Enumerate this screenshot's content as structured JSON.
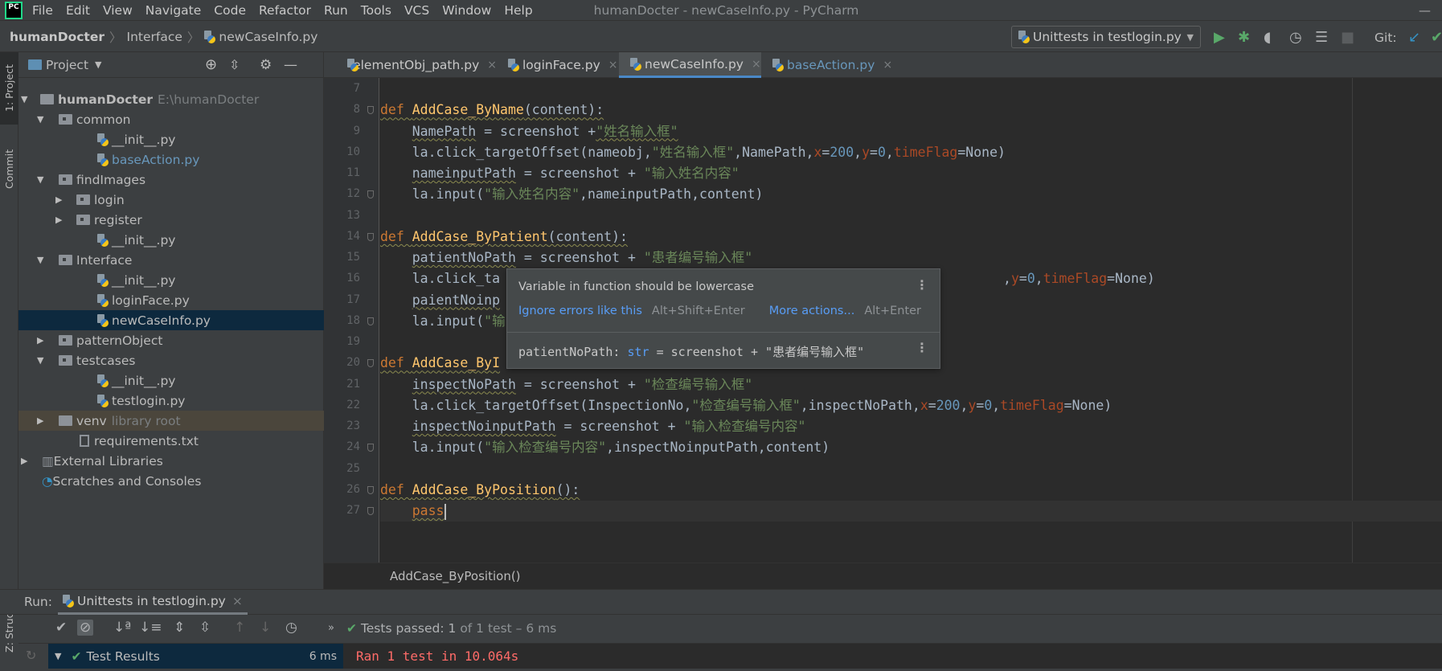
{
  "menu": {
    "items": [
      "File",
      "Edit",
      "View",
      "Navigate",
      "Code",
      "Refactor",
      "Run",
      "Tools",
      "VCS",
      "Window",
      "Help"
    ],
    "window_title": "humanDocter - newCaseInfo.py - PyCharm"
  },
  "navbar": {
    "crumbs": [
      "humanDocter",
      "Interface",
      "newCaseInfo.py"
    ],
    "run_config": "Unittests in testlogin.py",
    "git_label": "Git:"
  },
  "tool_strip": {
    "project": "1: Project",
    "commit": "Commit",
    "structure": "Z: Structure"
  },
  "sidebar": {
    "title": "Project",
    "tree": [
      {
        "label": "humanDocter",
        "hint": "E:\\humanDocter",
        "level": 0,
        "kind": "root",
        "expanded": true
      },
      {
        "label": "common",
        "level": 1,
        "kind": "folder",
        "expanded": true
      },
      {
        "label": "__init__.py",
        "level": 2,
        "kind": "py"
      },
      {
        "label": "baseAction.py",
        "level": 2,
        "kind": "py",
        "modified": true
      },
      {
        "label": "findImages",
        "level": 1,
        "kind": "folder",
        "expanded": true
      },
      {
        "label": "login",
        "level": 2,
        "kind": "folder",
        "expanded": false
      },
      {
        "label": "register",
        "level": 2,
        "kind": "folder",
        "expanded": false
      },
      {
        "label": "__init__.py",
        "level": 2,
        "kind": "py"
      },
      {
        "label": "Interface",
        "level": 1,
        "kind": "folder",
        "expanded": true
      },
      {
        "label": "__init__.py",
        "level": 2,
        "kind": "py"
      },
      {
        "label": "loginFace.py",
        "level": 2,
        "kind": "py"
      },
      {
        "label": "newCaseInfo.py",
        "level": 2,
        "kind": "py",
        "selected": true
      },
      {
        "label": "patternObject",
        "level": 1,
        "kind": "folder",
        "expanded": false
      },
      {
        "label": "testcases",
        "level": 1,
        "kind": "folder",
        "expanded": true
      },
      {
        "label": "__init__.py",
        "level": 2,
        "kind": "py"
      },
      {
        "label": "testlogin.py",
        "level": 2,
        "kind": "py"
      },
      {
        "label": "venv",
        "hint": "library root",
        "level": 1,
        "kind": "libfolder",
        "expanded": false
      },
      {
        "label": "requirements.txt",
        "level": 1,
        "kind": "txt"
      },
      {
        "label": "External Libraries",
        "level": 0,
        "kind": "libs",
        "expanded": false
      },
      {
        "label": "Scratches and Consoles",
        "level": 0,
        "kind": "scratch"
      }
    ]
  },
  "tabs": [
    {
      "label": "elementObj_path.py"
    },
    {
      "label": "loginFace.py"
    },
    {
      "label": "newCaseInfo.py",
      "active": true
    },
    {
      "label": "baseAction.py",
      "modified": true
    }
  ],
  "editor": {
    "lines": [
      {
        "num": "7",
        "tokens": []
      },
      {
        "num": "8",
        "fold": true,
        "tokens": [
          [
            "k",
            "def ",
            1
          ],
          [
            "f",
            "AddCase_ByName",
            1
          ],
          [
            "p",
            "(content):",
            1
          ]
        ]
      },
      {
        "num": "9",
        "tokens": [
          [
            "p",
            "    "
          ],
          [
            "p",
            "NamePath",
            1
          ],
          [
            "p",
            " = screenshot +"
          ],
          [
            "s",
            "\"姓名输入框\"",
            1
          ]
        ]
      },
      {
        "num": "10",
        "tokens": [
          [
            "p",
            "    la.click_targetOffset(nameobj,"
          ],
          [
            "s",
            "\"姓名输入框\""
          ],
          [
            "p",
            ",NamePath,"
          ],
          [
            "a",
            "x"
          ],
          [
            "p",
            "="
          ],
          [
            "n",
            "200"
          ],
          [
            "p",
            ","
          ],
          [
            "a",
            "y"
          ],
          [
            "p",
            "="
          ],
          [
            "n",
            "0"
          ],
          [
            "p",
            ","
          ],
          [
            "a",
            "timeFlag"
          ],
          [
            "p",
            "=None)"
          ]
        ]
      },
      {
        "num": "11",
        "tokens": [
          [
            "p",
            "    "
          ],
          [
            "p",
            "nameinputPath",
            1
          ],
          [
            "p",
            " = screenshot + "
          ],
          [
            "s",
            "\"输入姓名内容\""
          ]
        ]
      },
      {
        "num": "12",
        "fold": true,
        "tokens": [
          [
            "p",
            "    la.input("
          ],
          [
            "s",
            "\"输入姓名内容\""
          ],
          [
            "p",
            ",nameinputPath,content)"
          ]
        ]
      },
      {
        "num": "13",
        "tokens": []
      },
      {
        "num": "14",
        "fold": true,
        "tokens": [
          [
            "k",
            "def ",
            1
          ],
          [
            "f",
            "AddCase_ByPatient",
            1
          ],
          [
            "p",
            "(content):",
            1
          ]
        ]
      },
      {
        "num": "15",
        "tokens": [
          [
            "p",
            "    "
          ],
          [
            "p",
            "patientNoPath",
            1
          ],
          [
            "p",
            " = screenshot + "
          ],
          [
            "s",
            "\"患者编号输入框\""
          ]
        ]
      },
      {
        "num": "16",
        "tokens": [
          [
            "p",
            "    la.click_ta"
          ]
        ],
        "after_popup": [
          [
            "p",
            ","
          ],
          [
            "a",
            "y"
          ],
          [
            "p",
            "="
          ],
          [
            "n",
            "0"
          ],
          [
            "p",
            ","
          ],
          [
            "a",
            "timeFlag"
          ],
          [
            "p",
            "=None)"
          ]
        ]
      },
      {
        "num": "17",
        "tokens": [
          [
            "p",
            "    "
          ],
          [
            "p",
            "paientNoinp",
            1
          ]
        ]
      },
      {
        "num": "18",
        "fold": true,
        "tokens": [
          [
            "p",
            "    la.input("
          ],
          [
            "s",
            "\"输"
          ]
        ]
      },
      {
        "num": "19",
        "tokens": []
      },
      {
        "num": "20",
        "fold": true,
        "tokens": [
          [
            "k",
            "def ",
            1
          ],
          [
            "f",
            "AddCase_ByI",
            1
          ]
        ]
      },
      {
        "num": "21",
        "tokens": [
          [
            "p",
            "    "
          ],
          [
            "p",
            "inspectNoPath",
            1
          ],
          [
            "p",
            " = screenshot + "
          ],
          [
            "s",
            "\"检查编号输入框\""
          ]
        ]
      },
      {
        "num": "22",
        "tokens": [
          [
            "p",
            "    la.click_targetOffset(InspectionNo,"
          ],
          [
            "s",
            "\"检查编号输入框\""
          ],
          [
            "p",
            ",inspectNoPath,"
          ],
          [
            "a",
            "x"
          ],
          [
            "p",
            "="
          ],
          [
            "n",
            "200"
          ],
          [
            "p",
            ","
          ],
          [
            "a",
            "y"
          ],
          [
            "p",
            "="
          ],
          [
            "n",
            "0"
          ],
          [
            "p",
            ","
          ],
          [
            "a",
            "timeFlag"
          ],
          [
            "p",
            "=None)"
          ]
        ]
      },
      {
        "num": "23",
        "tokens": [
          [
            "p",
            "    "
          ],
          [
            "p",
            "inspectNoinputPath",
            1
          ],
          [
            "p",
            " = screenshot + "
          ],
          [
            "s",
            "\"输入检查编号内容\""
          ]
        ]
      },
      {
        "num": "24",
        "fold": true,
        "tokens": [
          [
            "p",
            "    la.input("
          ],
          [
            "s",
            "\"输入检查编号内容\""
          ],
          [
            "p",
            ",inspectNoinputPath,content)"
          ]
        ]
      },
      {
        "num": "25",
        "tokens": []
      },
      {
        "num": "26",
        "fold": true,
        "tokens": [
          [
            "k",
            "def ",
            1
          ],
          [
            "f",
            "AddCase_ByPosition",
            1
          ],
          [
            "p",
            "():",
            1
          ]
        ]
      },
      {
        "num": "27",
        "fold": true,
        "current": true,
        "tokens": [
          [
            "p",
            "    "
          ],
          [
            "k",
            "pass",
            1
          ]
        ]
      }
    ],
    "breadcrumb": "AddCase_ByPosition()"
  },
  "popup": {
    "message": "Variable in function should be lowercase",
    "action1": "Ignore errors like this",
    "shortcut1": "Alt+Shift+Enter",
    "action2": "More actions...",
    "shortcut2": "Alt+Enter",
    "sig_name": "patientNoPath: ",
    "sig_type": "str",
    "sig_rest": " = screenshot + \"患者编号输入框\""
  },
  "run": {
    "label": "Run:",
    "tab": "Unittests in testlogin.py",
    "status_prefix": "Tests passed:",
    "status_count": "1",
    "status_rest": "of 1 test – 6 ms",
    "results_label": "Test Results",
    "results_time": "6 ms",
    "console": "Ran 1 test in 10.064s"
  },
  "colors": {
    "keyword": "#cc7832",
    "function": "#ffc66d",
    "string": "#6a8759",
    "number": "#6897bb",
    "named_arg": "#aa4926",
    "link": "#589df6",
    "error": "#ff6b68",
    "run_green": "#59a869",
    "selection": "#0d293e"
  }
}
